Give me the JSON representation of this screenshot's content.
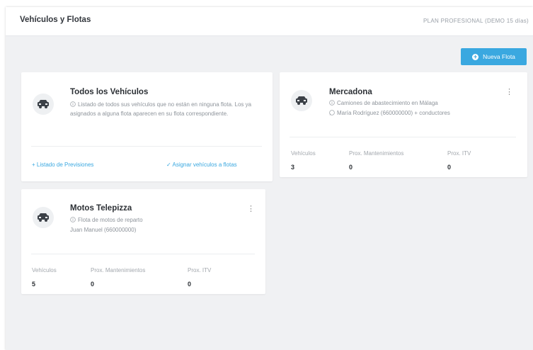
{
  "header": {
    "title": "Vehículos y Flotas",
    "plan": "PLAN PROFESIONAL (DEMO 15 días)"
  },
  "actions": {
    "new_fleet": "Nueva Flota"
  },
  "all_vehicles": {
    "title": "Todos los Vehículos",
    "description": "Listado de todos sus vehículos que no están en ninguna flota. Los ya asignados a alguna flota aparecen en su flota correspondiente.",
    "link_forecasts": "+ Listado de Previsiones",
    "link_assign": "✓ Asignar vehículos a flotas"
  },
  "fleets": [
    {
      "name": "Mercadona",
      "description": "Camiones de abastecimiento en Málaga",
      "contact": "María Rodríguez (660000000) + conductores",
      "stats_labels": [
        "Vehículos",
        "Prox. Mantenimientos",
        "Prox. ITV"
      ],
      "stats_values": [
        "3",
        "0",
        "0"
      ]
    },
    {
      "name": "Motos Telepizza",
      "description": "Flota de motos de reparto",
      "contact": "Juan Manuel (660000000)",
      "stats_labels": [
        "Vehículos",
        "Prox. Mantenimientos",
        "Prox. ITV"
      ],
      "stats_values": [
        "5",
        "0",
        "0"
      ]
    }
  ],
  "icons": {
    "vehicle": "car-icon",
    "info": "info-icon",
    "whatsapp": "whatsapp-icon",
    "more": "more-vertical-icon",
    "add": "plus-circle-icon"
  },
  "colors": {
    "accent": "#3aa8e0",
    "background": "#f0f1f3"
  }
}
